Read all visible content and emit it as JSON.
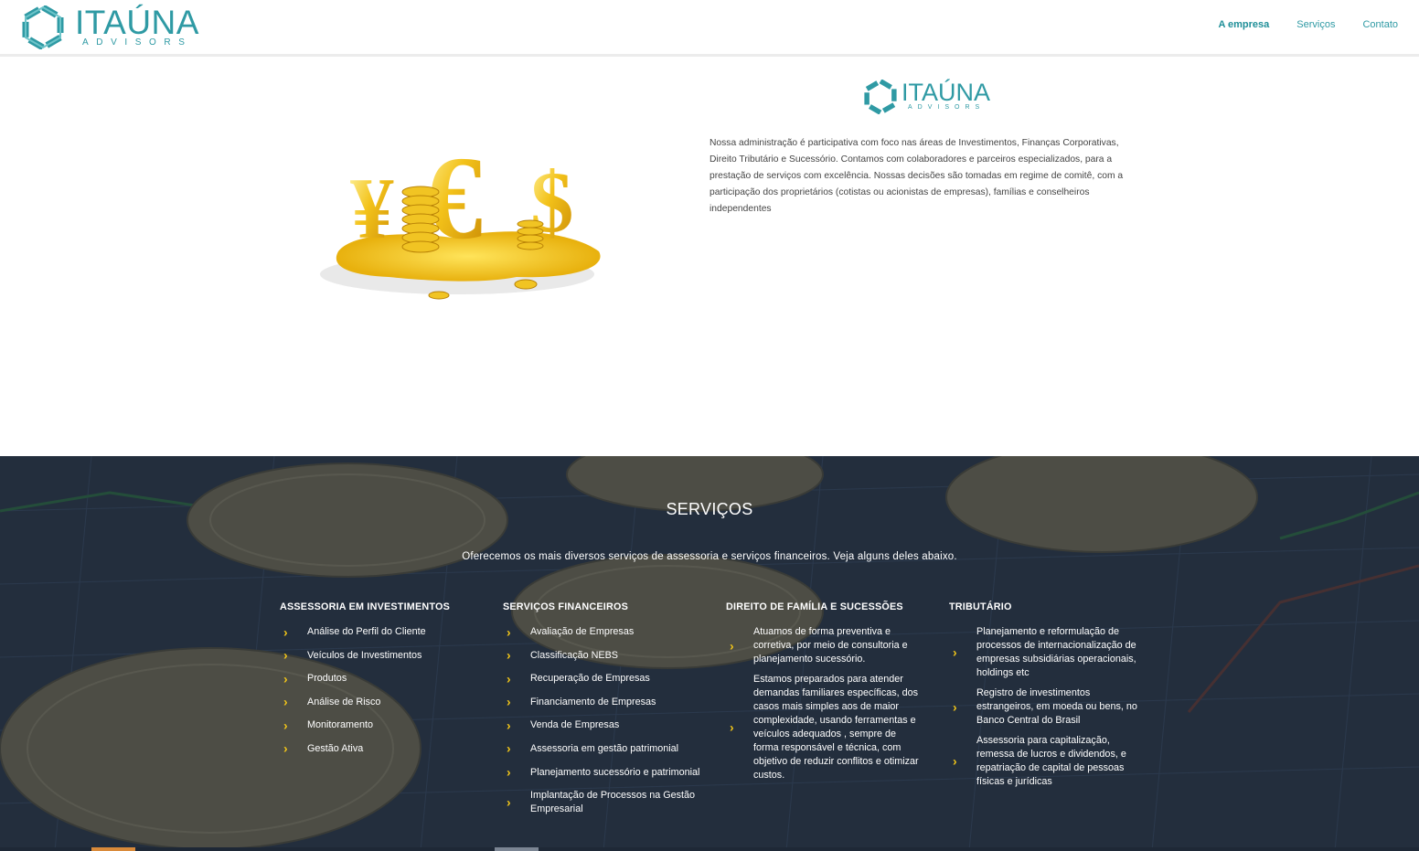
{
  "brand": {
    "name": "ITAÚNA",
    "tagline": "ADVISORS",
    "accent_color": "#2f9aa4"
  },
  "nav": {
    "items": [
      {
        "label": "A empresa",
        "active": true
      },
      {
        "label": "Serviços",
        "active": false
      },
      {
        "label": "Contato",
        "active": false
      }
    ]
  },
  "about": {
    "image_icon": "currency-gold-symbols-image",
    "text": "Nossa administração é participativa com foco nas áreas de Investimentos, Finanças Corporativas, Direito Tributário e Sucessório. Contamos com colaboradores e parceiros especializados, para a prestação de serviços com excelência. Nossas decisões são tomadas em regime de comitê, com a participação dos proprietários (cotistas ou acionistas de empresas), famílias e conselheiros independentes"
  },
  "services": {
    "title": "SERVIÇOS",
    "subtitle": "Oferecemos os mais diversos serviços de assessoria e serviços financeiros. Veja alguns deles abaixo.",
    "bullet_color": "#f0c419",
    "columns": [
      {
        "heading": "ASSESSORIA EM INVESTIMENTOS",
        "items": [
          "Análise do Perfil do Cliente",
          "Veículos de Investimentos",
          "Produtos",
          "Análise de Risco",
          "Monitoramento",
          "Gestão Ativa"
        ]
      },
      {
        "heading": "SERVIÇOS FINANCEIROS",
        "items": [
          "Avaliação de Empresas",
          "Classificação NEBS",
          "Recuperação de Empresas",
          "Financiamento de Empresas",
          "Venda de Empresas",
          "Assessoria em gestão patrimonial",
          "Planejamento sucessório e patrimonial",
          "Implantação de Processos na Gestão Empresarial"
        ]
      },
      {
        "heading": "DIREITO DE FAMÍLIA E SUCESSÕES",
        "items": [
          "Atuamos de forma preventiva e corretiva, por meio de consultoria e planejamento sucessório.",
          "Estamos preparados para atender demandas familiares específicas, dos casos mais simples aos de maior complexidade, usando ferramentas e veículos adequados , sempre de forma responsável e técnica, com objetivo de reduzir conflitos e otimizar custos."
        ]
      },
      {
        "heading": "TRIBUTÁRIO",
        "items": [
          "Planejamento e reformulação de processos de internacionalização de empresas subsidiárias operacionais, holdings etc",
          "Registro de investimentos estrangeiros, em moeda ou bens, no Banco Central do Brasil",
          "Assessoria para capitalização, remessa de lucros e dividendos, e repatriação de capital de pessoas físicas e jurídicas"
        ]
      }
    ]
  }
}
